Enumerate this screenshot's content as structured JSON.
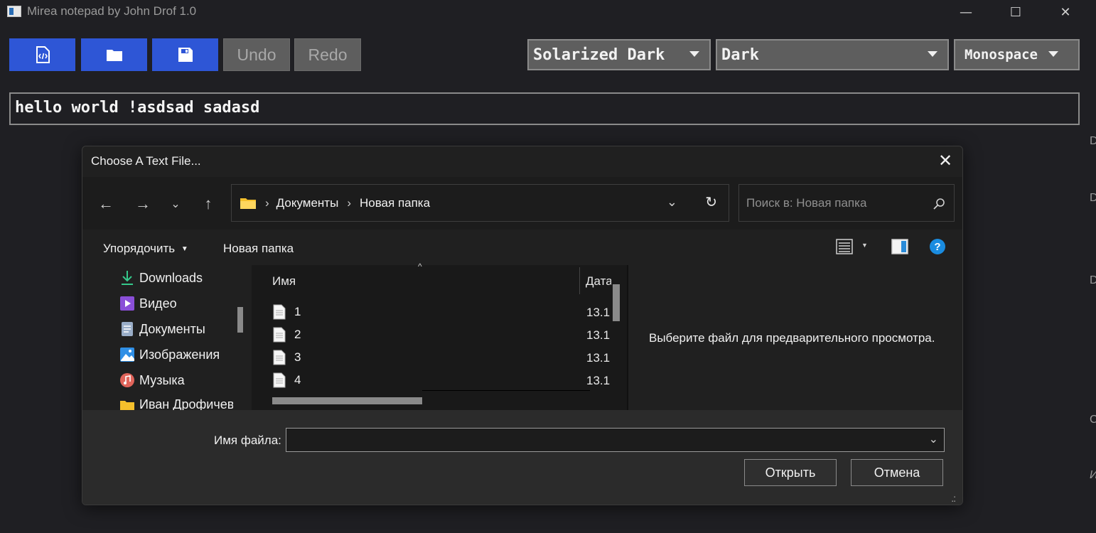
{
  "window": {
    "title": "Mirea notepad by John Drof 1.0",
    "minimize_glyph": "—",
    "maximize_glyph": "☐",
    "close_glyph": "✕"
  },
  "toolbar": {
    "buttons": [
      {
        "icon": "code-file-icon"
      },
      {
        "icon": "folder-open-icon"
      },
      {
        "icon": "save-disk-icon"
      }
    ],
    "undo_label": "Undo",
    "redo_label": "Redo",
    "theme_select": "Solarized Dark",
    "mode_select": "Dark",
    "font_select": "Monospace",
    "accent_color": "#2e56d6"
  },
  "editor": {
    "text": "hello world !asdsad sadasd"
  },
  "edge_glyphs": [
    "D",
    "D",
    "D",
    "C",
    "И"
  ],
  "dialog": {
    "title": "Choose A Text File...",
    "address": {
      "crumbs": [
        "Документы",
        "Новая папка"
      ]
    },
    "search_placeholder": "Поиск в: Новая папка",
    "commands": {
      "organize": "Упорядочить",
      "new_folder": "Новая папка"
    },
    "nav_items": [
      {
        "label": "Downloads",
        "icon": "download-icon"
      },
      {
        "label": "Видео",
        "icon": "video-icon"
      },
      {
        "label": "Документы",
        "icon": "documents-icon"
      },
      {
        "label": "Изображения",
        "icon": "pictures-icon"
      },
      {
        "label": "Музыка",
        "icon": "music-icon"
      },
      {
        "label": "Иван Дрофичев",
        "icon": "user-folder-icon"
      }
    ],
    "columns": {
      "name": "Имя",
      "date": "Дата"
    },
    "files": [
      {
        "name": "1",
        "date": "13.1"
      },
      {
        "name": "2",
        "date": "13.1"
      },
      {
        "name": "3",
        "date": "13.1"
      },
      {
        "name": "4",
        "date": "13.1"
      }
    ],
    "preview_text": "Выберите файл для предварительного просмотра.",
    "filename_label": "Имя файла:",
    "filename_value": "",
    "open_label": "Открыть",
    "cancel_label": "Отмена"
  }
}
